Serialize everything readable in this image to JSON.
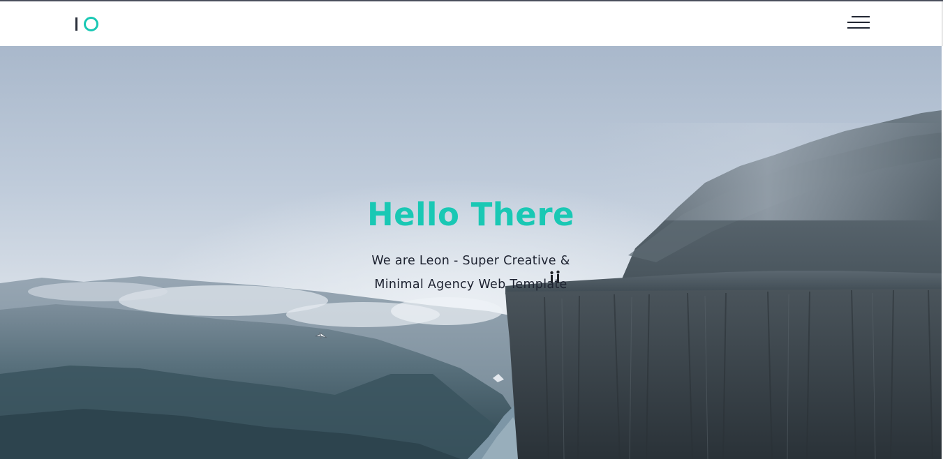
{
  "brand": {
    "logo_icon": "io-logo-icon",
    "accent_color": "#19c8b4"
  },
  "nav": {
    "menu_icon": "hamburger-menu-icon"
  },
  "hero": {
    "title": "Hello There",
    "subtitle": "We are Leon - Super Creative & Minimal Agency Web Template",
    "background": "misty-mountain-cliff-photo"
  }
}
